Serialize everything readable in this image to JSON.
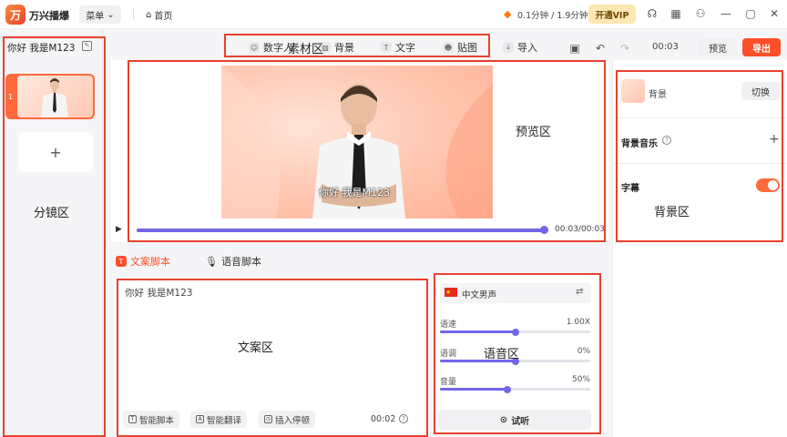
{
  "app": {
    "name": "万兴播爆",
    "logo_glyph": "万"
  },
  "topbar": {
    "menu_label": "菜单",
    "home_label": "首页",
    "usage_text": "0.1分钟 / 1.9分钟",
    "vip_label": "开通VIP",
    "icons": [
      "headset-icon",
      "grid-icon",
      "user-icon",
      "minimize-icon",
      "maximize-icon",
      "close-icon"
    ]
  },
  "project": {
    "title": "你好 我是M123"
  },
  "scenes": {
    "items": [
      {
        "index": "1"
      }
    ],
    "add_label": "+"
  },
  "toolbar": {
    "items": [
      {
        "label": "数字人",
        "icon": "digital-human-icon"
      },
      {
        "label": "背景",
        "icon": "background-icon"
      },
      {
        "label": "文字",
        "icon": "text-icon"
      },
      {
        "label": "贴图",
        "icon": "sticker-icon"
      },
      {
        "label": "导入",
        "icon": "import-icon"
      }
    ],
    "time": "00:03",
    "preview_label": "预览",
    "export_label": "导出"
  },
  "preview": {
    "subtitle": "你好 我是M123",
    "time": "00:03/00:03",
    "progress": 1.0
  },
  "script_tabs": {
    "text_tab": "文案脚本",
    "voice_tab": "语音脚本"
  },
  "script": {
    "text": "你好 我是M123",
    "chips": [
      "智能脚本",
      "智能翻译",
      "插入停顿"
    ],
    "duration": "00:02"
  },
  "voice": {
    "voice_name": "中文男声",
    "sliders": [
      {
        "label": "语速",
        "value": "1.00X",
        "fraction": 0.5
      },
      {
        "label": "语调",
        "value": "0%",
        "fraction": 0.5
      },
      {
        "label": "音量",
        "value": "50%",
        "fraction": 0.45
      }
    ],
    "listen_label": "试听"
  },
  "right_panel": {
    "background_label": "背景",
    "switch_label": "切换",
    "music_label": "背景音乐",
    "subtitle_label": "字幕",
    "subtitle_enabled": true
  },
  "annotations": {
    "materials": "素材区",
    "preview": "预览区",
    "scenes": "分镜区",
    "script": "文案区",
    "voice": "语音区",
    "background": "背景区"
  },
  "colors": {
    "accent": "#ff4e2a",
    "slider": "#7366e8",
    "annotation_box": "#e8412d"
  }
}
